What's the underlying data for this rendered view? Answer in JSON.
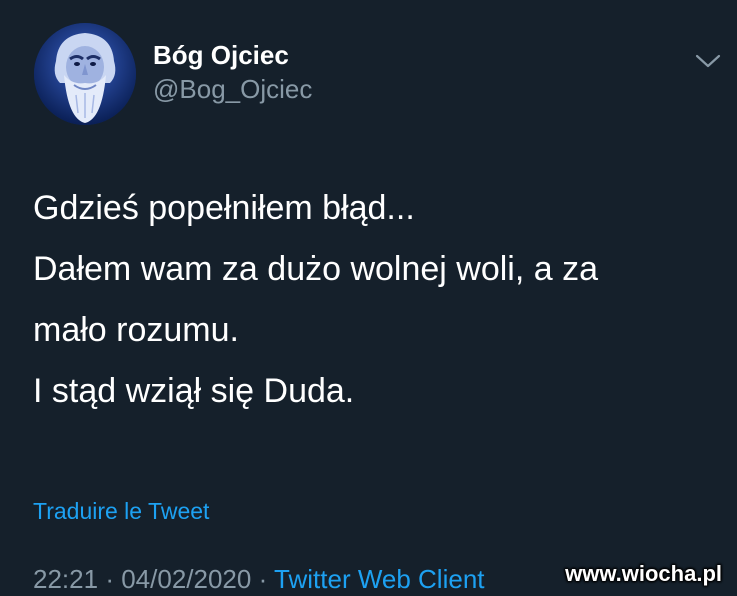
{
  "author": {
    "display_name": "Bóg Ojciec",
    "handle": "@Bog_Ojciec",
    "avatar_icon": "bearded-god-portrait"
  },
  "tweet": {
    "lines": [
      "Gdzieś popełniłem błąd...",
      "Dałem wam za dużo wolnej woli, a za",
      "mało rozumu.",
      "I stąd wziął się Duda."
    ]
  },
  "actions": {
    "translate_label": "Traduire le Tweet",
    "more_icon": "chevron-down-icon"
  },
  "meta": {
    "time": "22:21",
    "separator": "·",
    "date": "04/02/2020",
    "source": "Twitter Web Client"
  },
  "watermark": "www.wiocha.pl",
  "colors": {
    "background": "#15202b",
    "text": "#ffffff",
    "secondary": "#8899a6",
    "link": "#1da1f2"
  }
}
